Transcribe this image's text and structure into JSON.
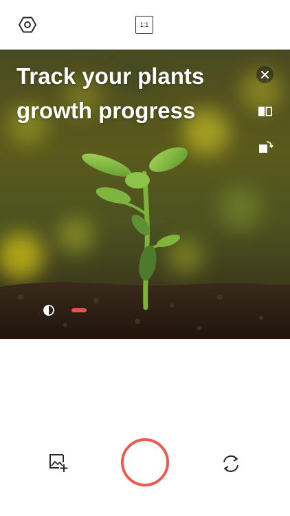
{
  "top_bar": {
    "settings_icon": "hexagon-settings-icon",
    "aspect_ratio_label": "1:1"
  },
  "preview": {
    "headline_line1": "Track your plants",
    "headline_line2": "growth progress",
    "close_icon": "close-icon",
    "compare_icon": "split-compare-icon",
    "rotate_icon": "rotate-icon",
    "contrast_icon": "contrast-icon",
    "overlay_slider_color": "#e5534b"
  },
  "bottom_bar": {
    "gallery_icon": "add-photo-icon",
    "shutter_color": "#ef5a4e",
    "switch_camera_icon": "switch-camera-icon"
  }
}
